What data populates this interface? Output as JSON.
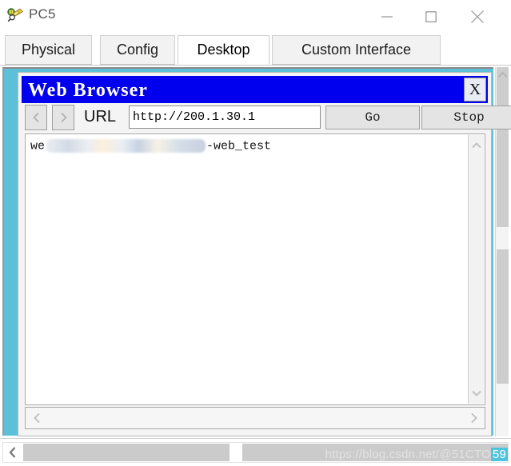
{
  "window": {
    "title": "PC5",
    "icon": "device-pc-icon",
    "controls": {
      "minimize": "minimize-icon",
      "maximize": "maximize-icon",
      "close": "close-icon"
    }
  },
  "tabs": [
    {
      "label": "Physical",
      "active": false
    },
    {
      "label": "Config",
      "active": false
    },
    {
      "label": "Desktop",
      "active": true
    },
    {
      "label": "Custom Interface",
      "active": false
    }
  ],
  "desktop": {
    "background_color": "#5cc0d8"
  },
  "browser": {
    "title": "Web Browser",
    "title_bar_color": "#0000ef",
    "close_label": "X",
    "toolbar": {
      "back_icon": "chevron-left-icon",
      "forward_icon": "chevron-right-icon",
      "url_label": "URL",
      "url_value": "http://200.1.30.1",
      "url_placeholder": "http://",
      "go_label": "Go",
      "stop_label": "Stop"
    },
    "content": {
      "text_prefix": "we",
      "text_suffix": "-web_test",
      "redacted": true
    },
    "scroll": {
      "up_icon": "chevron-up-icon",
      "down_icon": "chevron-down-icon",
      "left_icon": "chevron-left-icon",
      "right_icon": "chevron-right-icon"
    }
  },
  "outer_scroll": {
    "up_icon": "chevron-up-icon",
    "left_icon": "chevron-left-icon"
  },
  "watermark": {
    "text": "https://blog.csdn.net/@51CTO",
    "badge": "59"
  }
}
